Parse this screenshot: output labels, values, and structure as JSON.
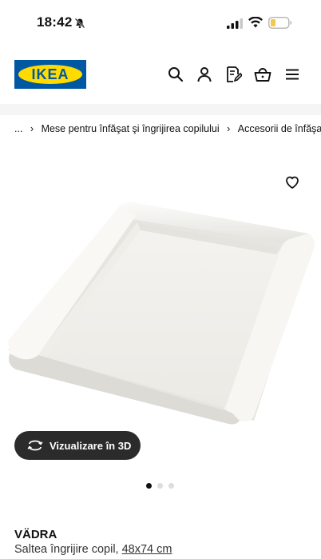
{
  "status_bar": {
    "time": "18:42"
  },
  "header": {
    "logo_text": "IKEA"
  },
  "breadcrumb": {
    "ellipsis": "...",
    "items": [
      "Mese pentru înfăşat şi îngrijirea copilului",
      "Accesorii de înfăşat"
    ]
  },
  "product": {
    "view3d_label": "Vizualizare în 3D",
    "name": "VÄDRA",
    "description": "Saltea îngrijire copil,",
    "size": "48x74 cm",
    "image_dots": {
      "count": 3,
      "active": 1
    }
  },
  "colors": {
    "brand_blue": "#0058a3",
    "brand_yellow": "#ffdb00",
    "button_dark": "#2b2b2b"
  }
}
